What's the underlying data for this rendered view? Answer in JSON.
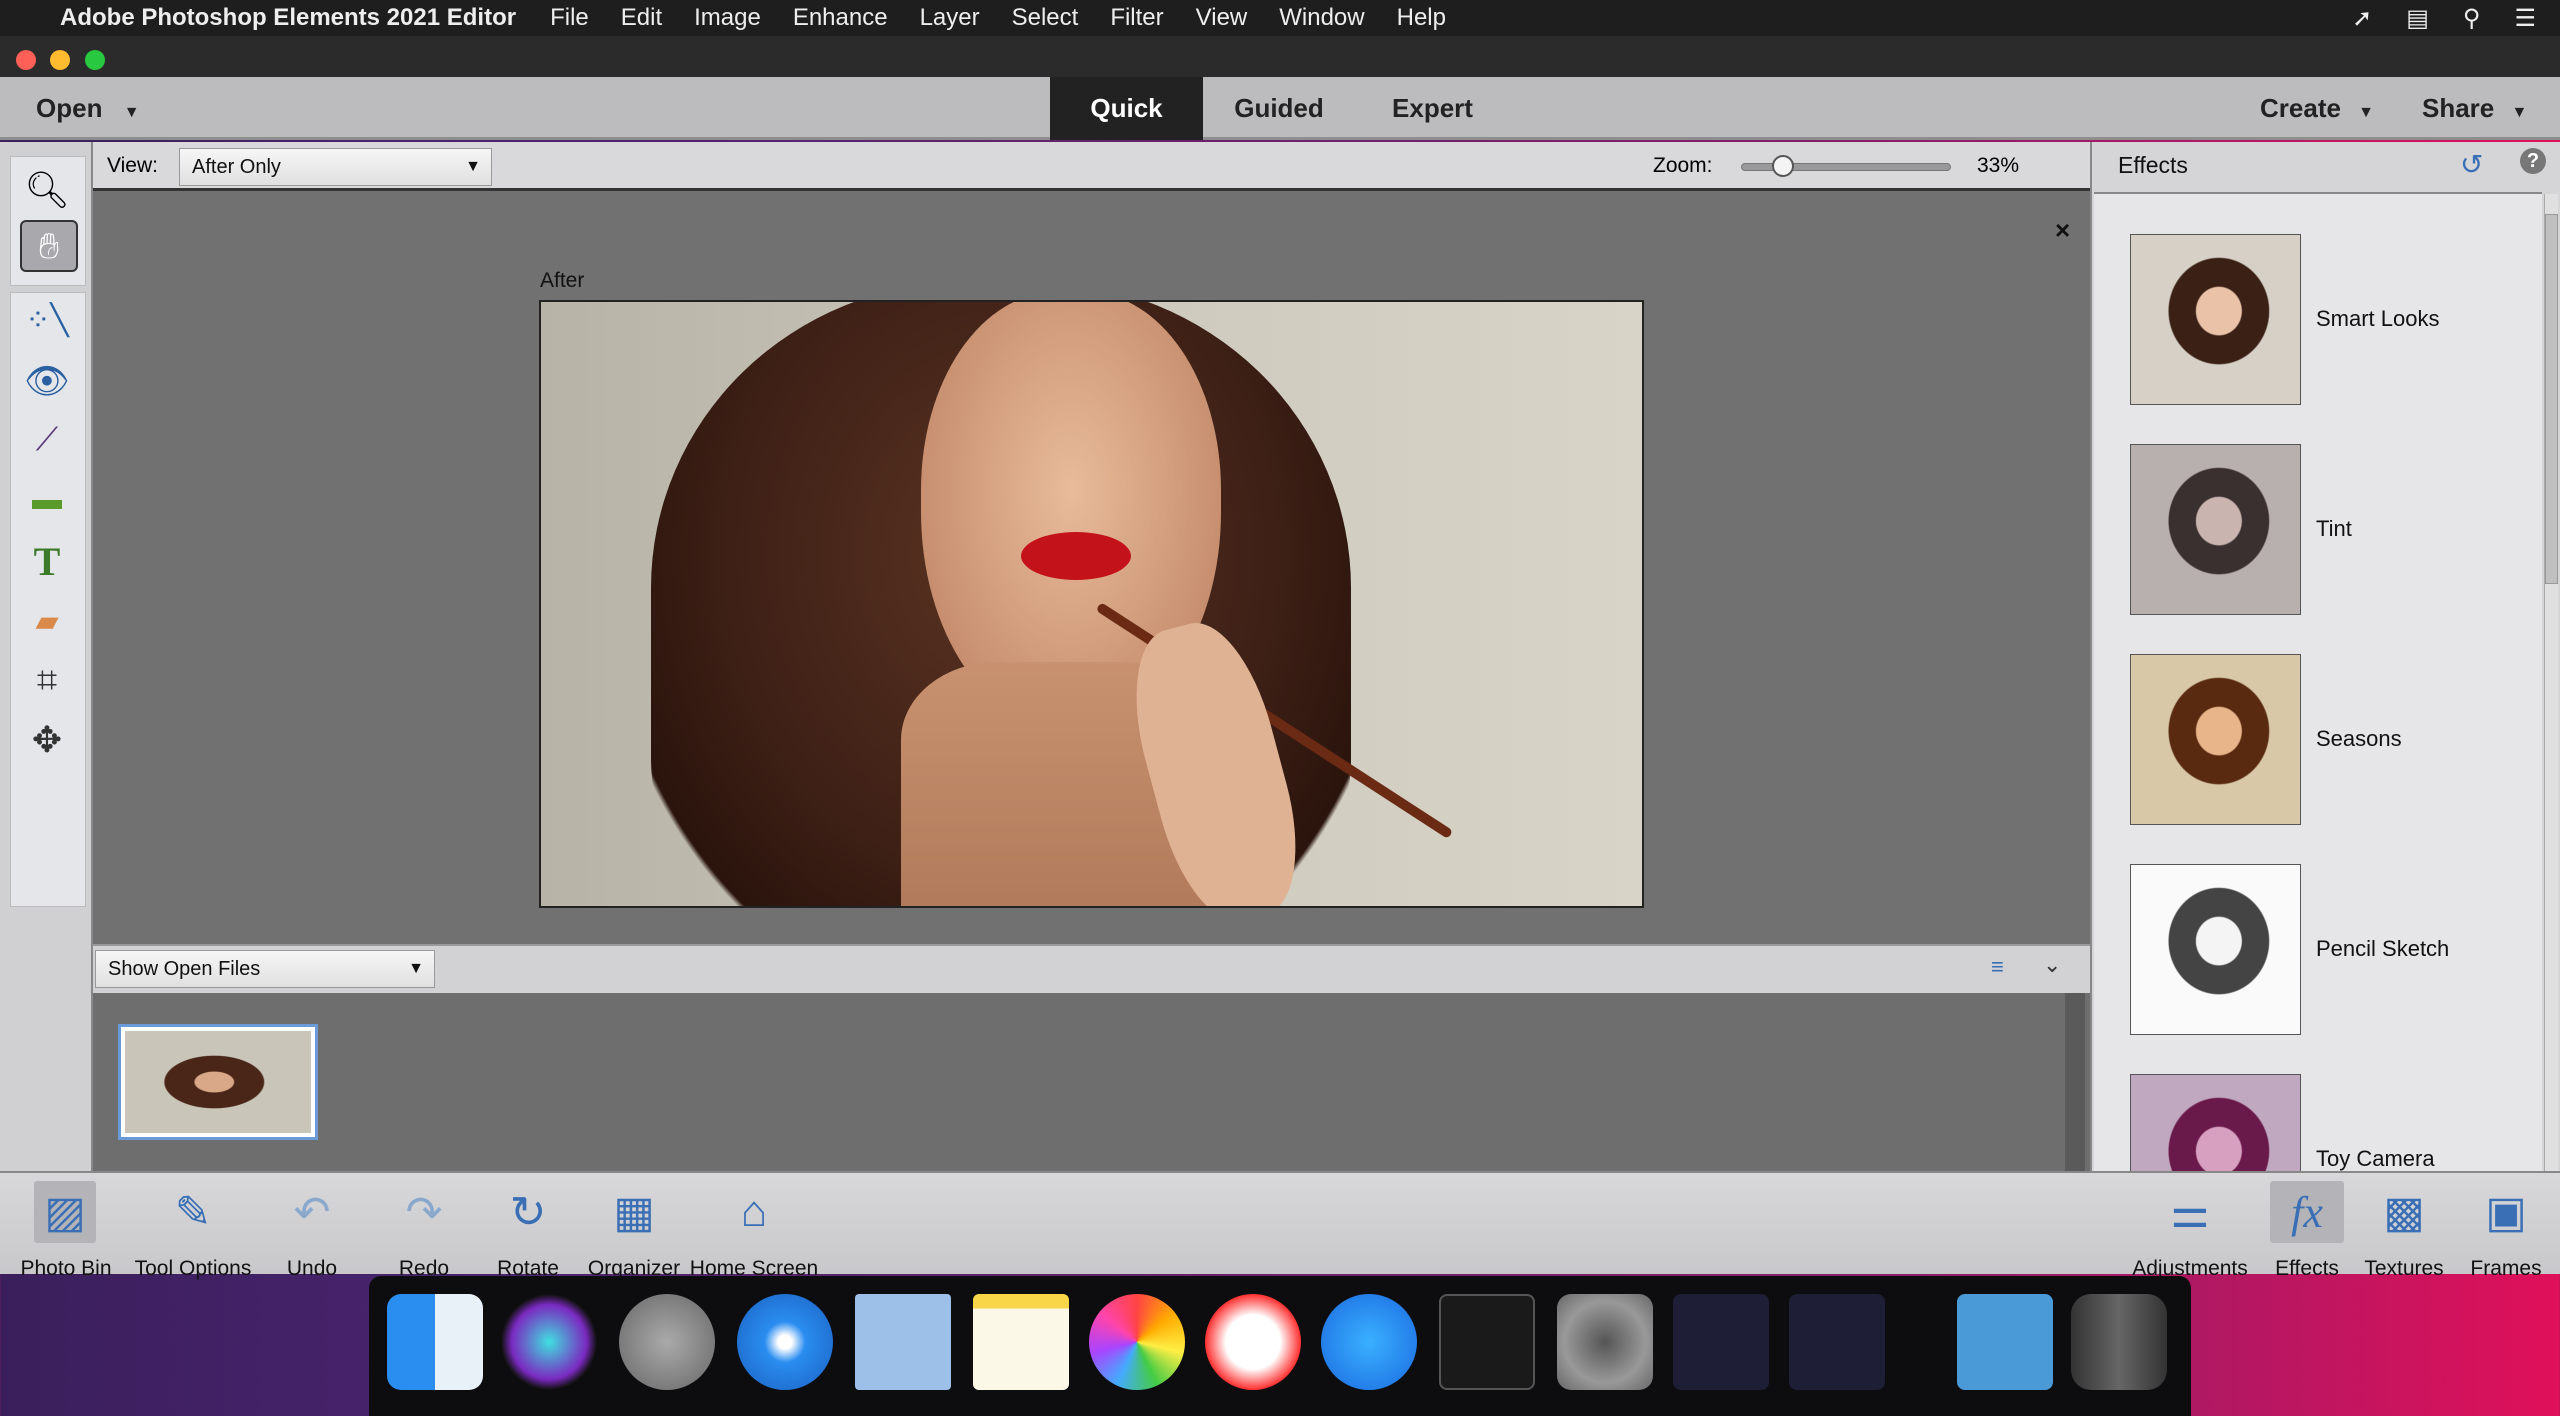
{
  "menubar": {
    "app_name": "Adobe Photoshop Elements 2021 Editor",
    "items": [
      "File",
      "Edit",
      "Image",
      "Enhance",
      "Layer",
      "Select",
      "Filter",
      "View",
      "Window",
      "Help"
    ]
  },
  "topbar": {
    "open": "Open",
    "tabs": [
      "Quick",
      "Guided",
      "Expert"
    ],
    "active_tab": "Quick",
    "create": "Create",
    "share": "Share"
  },
  "options": {
    "view_label": "View:",
    "view_value": "After Only",
    "zoom_label": "Zoom:",
    "zoom_value": "33%",
    "zoom_percent": 33
  },
  "canvas": {
    "image_label": "After"
  },
  "bin": {
    "dropdown": "Show Open Files"
  },
  "panel": {
    "title": "Effects",
    "effects": [
      "Smart Looks",
      "Tint",
      "Seasons",
      "Pencil Sketch",
      "Toy Camera"
    ]
  },
  "bottom": {
    "left": [
      "Photo Bin",
      "Tool Options",
      "Undo",
      "Redo",
      "Rotate",
      "Organizer",
      "Home Screen"
    ],
    "right": [
      "Adjustments",
      "Effects",
      "Textures",
      "Frames"
    ]
  },
  "colors": {
    "accent": "#3a6fb5",
    "active_tab_bg": "#222222"
  }
}
